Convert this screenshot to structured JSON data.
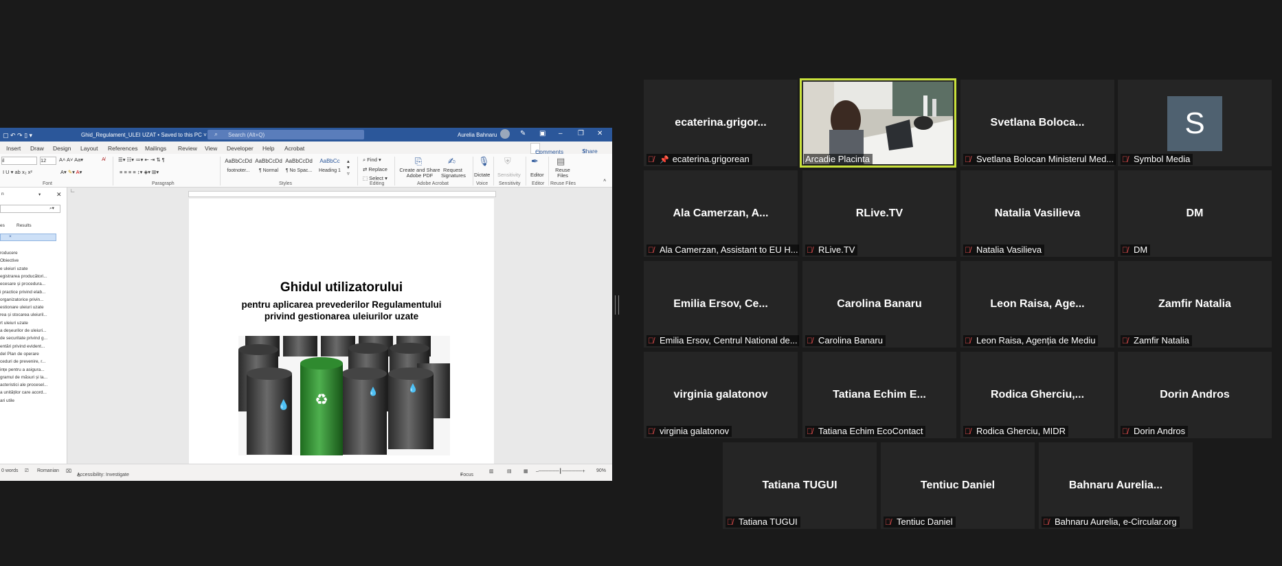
{
  "word": {
    "title": "Ghid_Regulament_ULEI UZAT • Saved to this PC ˅",
    "search_placeholder": "Search (Alt+Q)",
    "user": "Aurelia Bahnaru",
    "tabs": [
      "Insert",
      "Draw",
      "Design",
      "Layout",
      "References",
      "Mailings",
      "Review",
      "View",
      "Developer",
      "Help",
      "Acrobat"
    ],
    "comments_label": "Comments",
    "share_label": "Share",
    "font_size": "12",
    "styles": [
      {
        "preview": "AaBbCcDd",
        "name": "footnoter..."
      },
      {
        "preview": "AaBbCcDd",
        "name": "¶ Normal"
      },
      {
        "preview": "AaBbCcDd",
        "name": "¶ No Spac..."
      },
      {
        "preview": "AaBbCc",
        "name": "Heading 1"
      }
    ],
    "groups": [
      "Font",
      "Paragraph",
      "Styles",
      "Editing",
      "Adobe Acrobat",
      "Voice",
      "Sensitivity",
      "Editor",
      "Reuse Files"
    ],
    "editing": {
      "find": "Find",
      "replace": "Replace",
      "select": "Select"
    },
    "acrobat": {
      "create": "Create and Share Adobe PDF",
      "request": "Request Signatures"
    },
    "voice": {
      "dictate": "Dictate"
    },
    "sensitivity": {
      "label": "Sensitivity"
    },
    "editor": {
      "label": "Editor"
    },
    "reuse": {
      "label": "Reuse Files"
    },
    "nav": {
      "tabs": [
        "es",
        "Results"
      ],
      "items": [
        "roducere",
        "Obiective",
        "e uleiuri uzate",
        "egistrarea producători...",
        "ecesare și procedura...",
        "i practice privind elab...",
        "organizatorice privin...",
        "estionare uleiuri uzate",
        "rea și stocarea uleiuril...",
        "rt uleiuri uzate",
        "a deșeurilor de uleiuri...",
        "de securitate privind g...",
        "entări privind evident...",
        "del Plan de operare",
        "ceduri de prevenire, r...",
        "ințe pentru a asigura...",
        "gramul de măsuri și la...",
        "acteristici ale procesel...",
        "a unităților care acord...",
        "ari utile"
      ]
    },
    "document": {
      "title": "Ghidul utilizatorului",
      "subtitle_line1": "pentru aplicarea prevederilor Regulamentului",
      "subtitle_line2": "privind gestionarea uleiurilor uzate"
    },
    "status": {
      "words": "0 words",
      "language": "Romanian",
      "accessibility": "Accessibility: Investigate",
      "focus": "Focus",
      "zoom": "90%"
    }
  },
  "participants": [
    {
      "name": "ecaterina.grigor...",
      "label": "ecaterina.grigorean",
      "pinned": true
    },
    {
      "name": "",
      "label": "Arcadie Placinta",
      "video": true,
      "active": true
    },
    {
      "name": "Svetlana  Boloca...",
      "label": "Svetlana Bolocan Ministerul Med..."
    },
    {
      "name": "",
      "label": "Symbol Media",
      "avatar": "S"
    },
    {
      "name": "Ala Camerzan, A...",
      "label": "Ala Camerzan, Assistant to EU H..."
    },
    {
      "name": "RLive.TV",
      "label": "RLive.TV"
    },
    {
      "name": "Natalia Vasilieva",
      "label": "Natalia Vasilieva"
    },
    {
      "name": "DM",
      "label": "DM"
    },
    {
      "name": "Emilia Ersov,  Ce...",
      "label": "Emilia Ersov, Centrul National de..."
    },
    {
      "name": "Carolina Banaru",
      "label": "Carolina Banaru"
    },
    {
      "name": "Leon Raisa,  Age...",
      "label": "Leon Raisa, Agenția de Mediu"
    },
    {
      "name": "Zamfir Natalia",
      "label": "Zamfir Natalia"
    },
    {
      "name": "virginia galatonov",
      "label": "virginia galatonov"
    },
    {
      "name": "Tatiana Echim  E...",
      "label": "Tatiana Echim EcoContact"
    },
    {
      "name": "Rodica  Gherciu,...",
      "label": "Rodica Gherciu, MIDR"
    },
    {
      "name": "Dorin Andros",
      "label": "Dorin Andros"
    },
    {
      "name": "Tatiana TUGUI",
      "label": "Tatiana TUGUI"
    },
    {
      "name": "Tentiuc Daniel",
      "label": "Tentiuc Daniel"
    },
    {
      "name": "Bahnaru  Aurelia...",
      "label": "Bahnaru Aurelia, e-Circular.org"
    }
  ],
  "colors": {
    "accent": "#c9e13b",
    "mute": "#e04c4c",
    "word_blue": "#2b579a",
    "avatar_bg": "#4f6170"
  }
}
